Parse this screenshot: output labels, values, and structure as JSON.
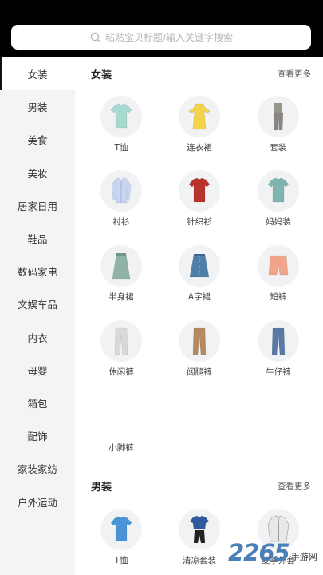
{
  "search": {
    "placeholder": "粘贴宝贝标题/输入关键字搜索"
  },
  "sidebar": {
    "items": [
      {
        "label": "女装"
      },
      {
        "label": "男装"
      },
      {
        "label": "美食"
      },
      {
        "label": "美妆"
      },
      {
        "label": "居家日用"
      },
      {
        "label": "鞋品"
      },
      {
        "label": "数码家电"
      },
      {
        "label": "文娱车品"
      },
      {
        "label": "内衣"
      },
      {
        "label": "母婴"
      },
      {
        "label": "箱包"
      },
      {
        "label": "配饰"
      },
      {
        "label": "家装家纺"
      },
      {
        "label": "户外运动"
      }
    ],
    "active_index": 0
  },
  "sections": [
    {
      "title": "女装",
      "more": "查看更多",
      "items": [
        {
          "label": "T恤",
          "icon": "tshirt-icon",
          "color": "#a8d8d0"
        },
        {
          "label": "连衣裙",
          "icon": "dress-icon",
          "color": "#f2d34a"
        },
        {
          "label": "套装",
          "icon": "suit-icon",
          "color": "#8a8580"
        },
        {
          "label": "衬衫",
          "icon": "shirt-icon",
          "color": "#c9d6f2"
        },
        {
          "label": "针织衫",
          "icon": "knit-icon",
          "color": "#b8332b"
        },
        {
          "label": "妈妈装",
          "icon": "mom-top-icon",
          "color": "#7fb5b0"
        },
        {
          "label": "半身裙",
          "icon": "skirt-icon",
          "color": "#8fb3a8"
        },
        {
          "label": "A字裙",
          "icon": "a-skirt-icon",
          "color": "#4f7ea8"
        },
        {
          "label": "短裤",
          "icon": "shorts-icon",
          "color": "#f2a48a"
        },
        {
          "label": "休闲裤",
          "icon": "casual-pants-icon",
          "color": "#d9d9d9"
        },
        {
          "label": "阔腿裤",
          "icon": "wide-pants-icon",
          "color": "#b58a62"
        },
        {
          "label": "牛仔裤",
          "icon": "jeans-icon",
          "color": "#5a79a6"
        },
        {
          "label": "小脚裤",
          "icon": "skinny-pants-icon",
          "color": "#ffffff"
        }
      ]
    },
    {
      "title": "男装",
      "more": "查看更多",
      "items": [
        {
          "label": "T恤",
          "icon": "men-tshirt-icon",
          "color": "#4a93d6"
        },
        {
          "label": "清凉套装",
          "icon": "men-set-icon",
          "color": "#2f5a9e"
        },
        {
          "label": "夏季外套",
          "icon": "jacket-icon",
          "color": "#e8e8e8"
        }
      ]
    }
  ],
  "watermark": {
    "number": "2265",
    "text": "手游网"
  }
}
